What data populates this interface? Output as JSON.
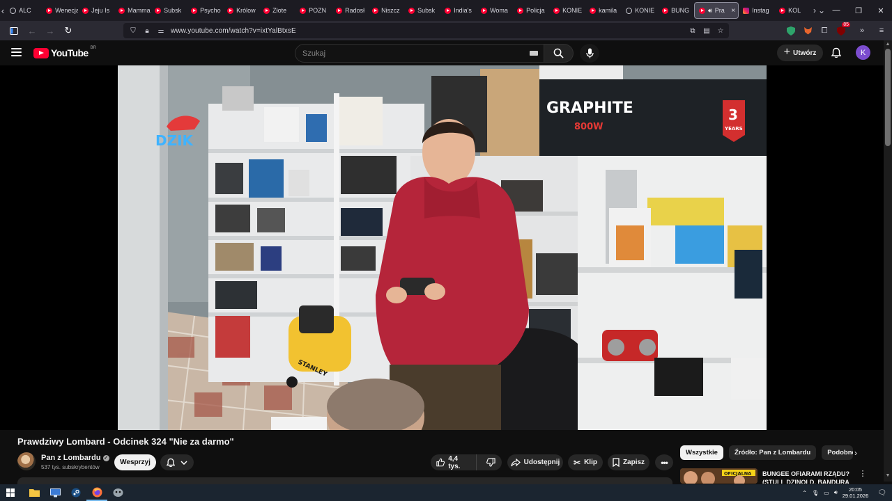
{
  "browser": {
    "tabs": [
      {
        "label": "ALC",
        "favicon": "generic-icon"
      },
      {
        "label": "Wenecja",
        "favicon": "youtube-icon"
      },
      {
        "label": "Jeju Is",
        "favicon": "youtube-icon"
      },
      {
        "label": "Mamma",
        "favicon": "youtube-icon"
      },
      {
        "label": "Subsk",
        "favicon": "youtube-icon"
      },
      {
        "label": "Psycho",
        "favicon": "youtube-icon"
      },
      {
        "label": "Królow",
        "favicon": "youtube-icon"
      },
      {
        "label": "Złote",
        "favicon": "youtube-icon"
      },
      {
        "label": "POZN",
        "favicon": "youtube-icon"
      },
      {
        "label": "Radosł",
        "favicon": "youtube-icon"
      },
      {
        "label": "Niszcz",
        "favicon": "youtube-icon"
      },
      {
        "label": "Subsk",
        "favicon": "youtube-icon"
      },
      {
        "label": "India's",
        "favicon": "youtube-icon"
      },
      {
        "label": "Woma",
        "favicon": "youtube-icon"
      },
      {
        "label": "Policja",
        "favicon": "youtube-icon"
      },
      {
        "label": "KONIE",
        "favicon": "youtube-icon"
      },
      {
        "label": "kamila",
        "favicon": "youtube-icon"
      },
      {
        "label": "KONIE",
        "favicon": "generic-icon"
      },
      {
        "label": "BUNG",
        "favicon": "youtube-icon"
      }
    ],
    "active_tab": {
      "label": "Pra",
      "favicon": "youtube-icon",
      "audio": "speaker-icon",
      "close": "×"
    },
    "trailing_tabs": [
      {
        "label": "Instag",
        "favicon": "instagram-icon"
      },
      {
        "label": "KOL",
        "favicon": "youtube-icon"
      }
    ],
    "url": "www.youtube.com/watch?v=ixtYalBtxsE",
    "extension_badge": "85"
  },
  "youtube": {
    "logo_text": "YouTube",
    "region": "BR",
    "search_placeholder": "Szukaj",
    "create_label": "Utwórz",
    "avatar_letter": "K"
  },
  "video": {
    "title": "Prawdziwy Lombard - Odcinek 324 \"Nie za darmo\"",
    "channel": "Pan z Lombardu",
    "subscribers": "537 tys. subskrybentów",
    "support_label": "Wesprzyj",
    "likes": "4,4 tys.",
    "share_label": "Udostępnij",
    "clip_label": "Klip",
    "save_label": "Zapisz",
    "scene": {
      "neon_sign": "DZIK",
      "box_brand": "GRAPHITE",
      "box_power": "800W",
      "box_warranty_years": "3",
      "box_warranty_label": "YEARS",
      "compressor_brand": "STANLEY"
    }
  },
  "sidebar": {
    "chips": [
      "Wszystkie",
      "Źródło: Pan z Lombardu",
      "Podobne"
    ],
    "recommendation": {
      "title": "BUNGEE OFIARAMI RZĄDU? (STULL DZINOLD, BANDURA",
      "thumb_text": "OFICJALNA"
    }
  },
  "taskbar": {
    "time": "20:05",
    "date": "29.01.2026"
  }
}
